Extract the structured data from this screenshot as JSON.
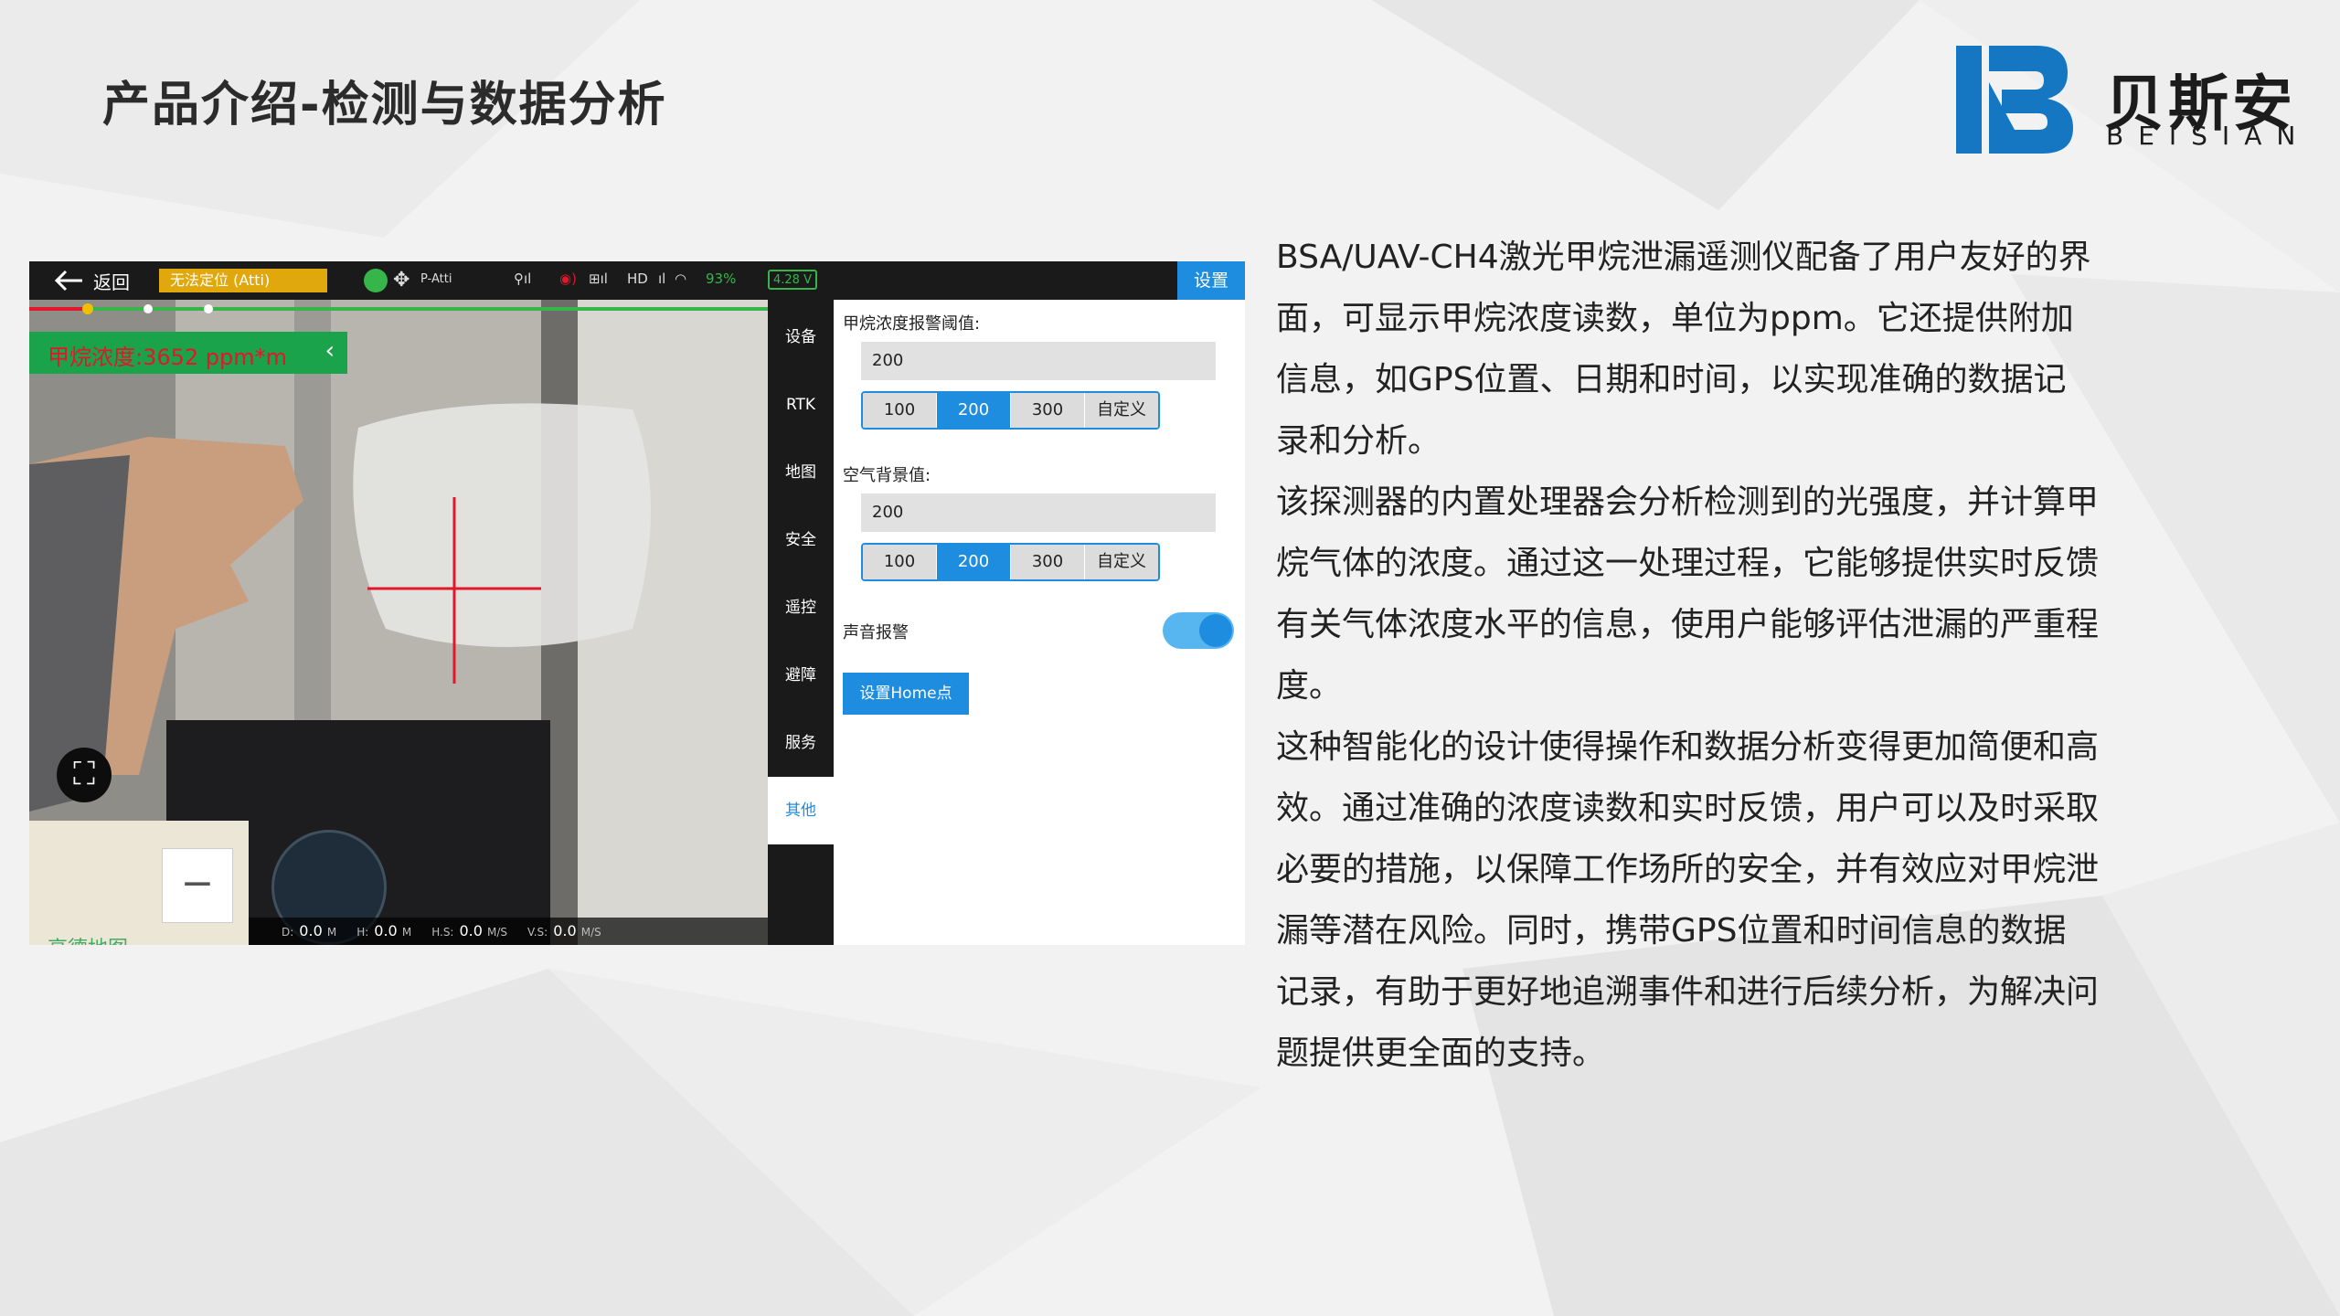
{
  "slide": {
    "title": "产品介绍-检测与数据分析",
    "brand": {
      "cn": "贝斯安",
      "en": "BEISIAN",
      "color": "#1576c2"
    },
    "description": [
      "BSA/UAV-CH4激光甲烷泄漏遥测仪配备了用户友好的界面，可显示甲烷浓度读数，单位为ppm。它还提供附加信息，如GPS位置、日期和时间，以实现准确的数据记录和分析。",
      "该探测器的内置处理器会分析检测到的光强度，并计算甲烷气体的浓度。通过这一处理过程，它能够提供实时反馈有关气体浓度水平的信息，使用户能够评估泄漏的严重程度。",
      "这种智能化的设计使得操作和数据分析变得更加简便和高效。通过准确的浓度读数和实时反馈，用户可以及时采取必要的措施，以保障工作场所的安全，并有效应对甲烷泄漏等潜在风险。同时，携带GPS位置和时间信息的数据记录，有助于更好地追溯事件和进行后续分析，为解决问题提供更全面的支持。"
    ]
  },
  "app": {
    "topbar": {
      "back_label": "返回",
      "gps_status": "无法定位 (Atti)",
      "flight_mode": "P-Atti",
      "hd": "HD",
      "battery_percent": "93%",
      "voltage": "4.28 V",
      "settings_tab": "设置"
    },
    "camera": {
      "ch4_reading": "甲烷浓度:3652 ppm*m",
      "map_brand": "高德地图",
      "telemetry": [
        {
          "label": "D:",
          "value": "0.0",
          "unit": "M"
        },
        {
          "label": "H:",
          "value": "0.0",
          "unit": "M"
        },
        {
          "label": "H.S:",
          "value": "0.0",
          "unit": "M/S"
        },
        {
          "label": "V.S:",
          "value": "0.0",
          "unit": "M/S"
        }
      ]
    },
    "side_nav": [
      "设备",
      "RTK",
      "地图",
      "安全",
      "遥控",
      "避障",
      "服务",
      "其他"
    ],
    "side_nav_active": 7,
    "panel": {
      "ch4_threshold_label": "甲烷浓度报警阈值:",
      "ch4_threshold_value": "200",
      "ch4_presets": [
        "100",
        "200",
        "300",
        "自定义"
      ],
      "ch4_selected": 1,
      "air_bg_label": "空气背景值:",
      "air_bg_value": "200",
      "air_presets": [
        "100",
        "200",
        "300",
        "自定义"
      ],
      "air_selected": 1,
      "sound_alarm_label": "声音报警",
      "sound_alarm_on": true,
      "home_button": "设置Home点"
    }
  }
}
